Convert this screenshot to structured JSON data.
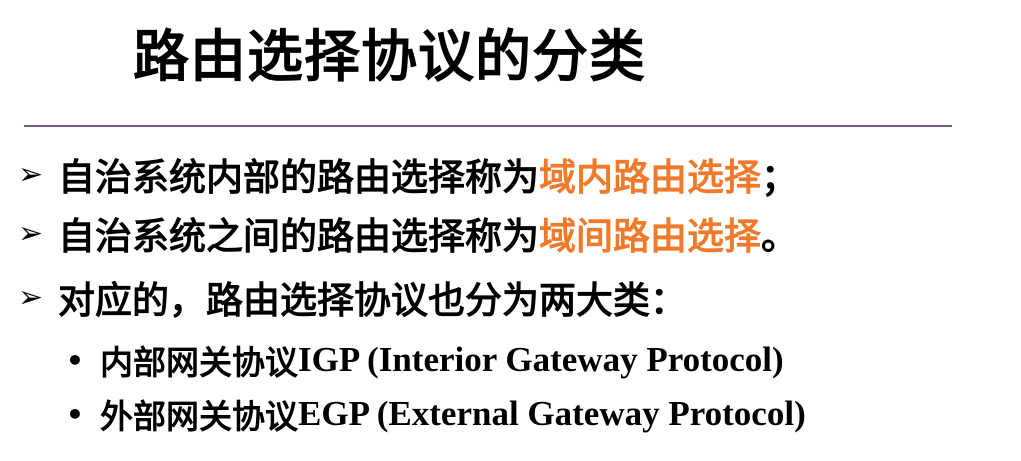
{
  "slide": {
    "title": "路由选择协议的分类",
    "bullets": [
      {
        "marker": "➢",
        "prefix": "自治系统内部的路由选择称为",
        "highlight": "域内路由选择",
        "suffix": "；"
      },
      {
        "marker": "➢",
        "prefix": "自治系统之间的路由选择称为",
        "highlight": "域间路由选择",
        "suffix": "。"
      },
      {
        "marker": "➢",
        "text": "对应的，路由选择协议也分为两大类："
      }
    ],
    "sub_bullets": [
      {
        "marker": "•",
        "cn": "内部网关协议",
        "en": "IGP (Interior Gateway Protocol)"
      },
      {
        "marker": "•",
        "cn": "外部网关协议",
        "en": "EGP (External Gateway Protocol)"
      }
    ],
    "colors": {
      "highlight": "#f07a2c",
      "divider": "#7a5a8a",
      "text": "#000000"
    }
  }
}
